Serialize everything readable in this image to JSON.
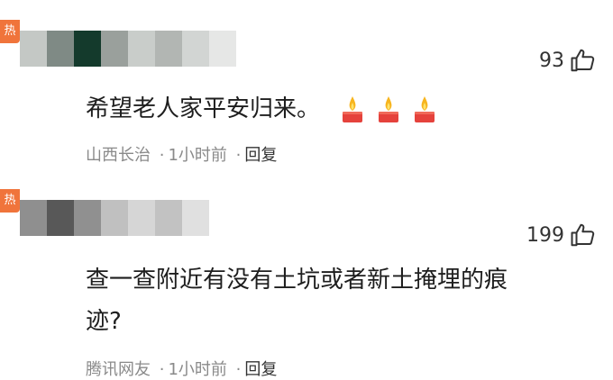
{
  "comments": [
    {
      "badge": "热",
      "likes": "93",
      "text": "希望老人家平安归来。",
      "emoji": [
        "candle-emoji",
        "candle-emoji",
        "candle-emoji"
      ],
      "location": "山西长治",
      "time": "1小时前",
      "reply_label": "回复"
    },
    {
      "badge": "热",
      "likes": "199",
      "text_line1": "查一查附近有没有土坑或者新土掩埋的痕",
      "text_line2": "迹?",
      "location": "腾讯网友",
      "time": "1小时前",
      "reply_label": "回复"
    }
  ],
  "colors": {
    "badge": "#f0743b",
    "meta_text": "#8a8a8a",
    "main_text": "#1e1e1e"
  },
  "avatars": {
    "top": [
      "#c4c8c5",
      "#7f8a85",
      "#143a2c",
      "#9aa09c",
      "#c9cdca",
      "#b2b6b3",
      "#d2d5d3",
      "#e6e7e6"
    ],
    "bottom": [
      "#8f8f8f",
      "#585858",
      "#909090",
      "#c0c0c0",
      "#d6d6d6",
      "#c2c2c2",
      "#e0e0e0"
    ]
  }
}
